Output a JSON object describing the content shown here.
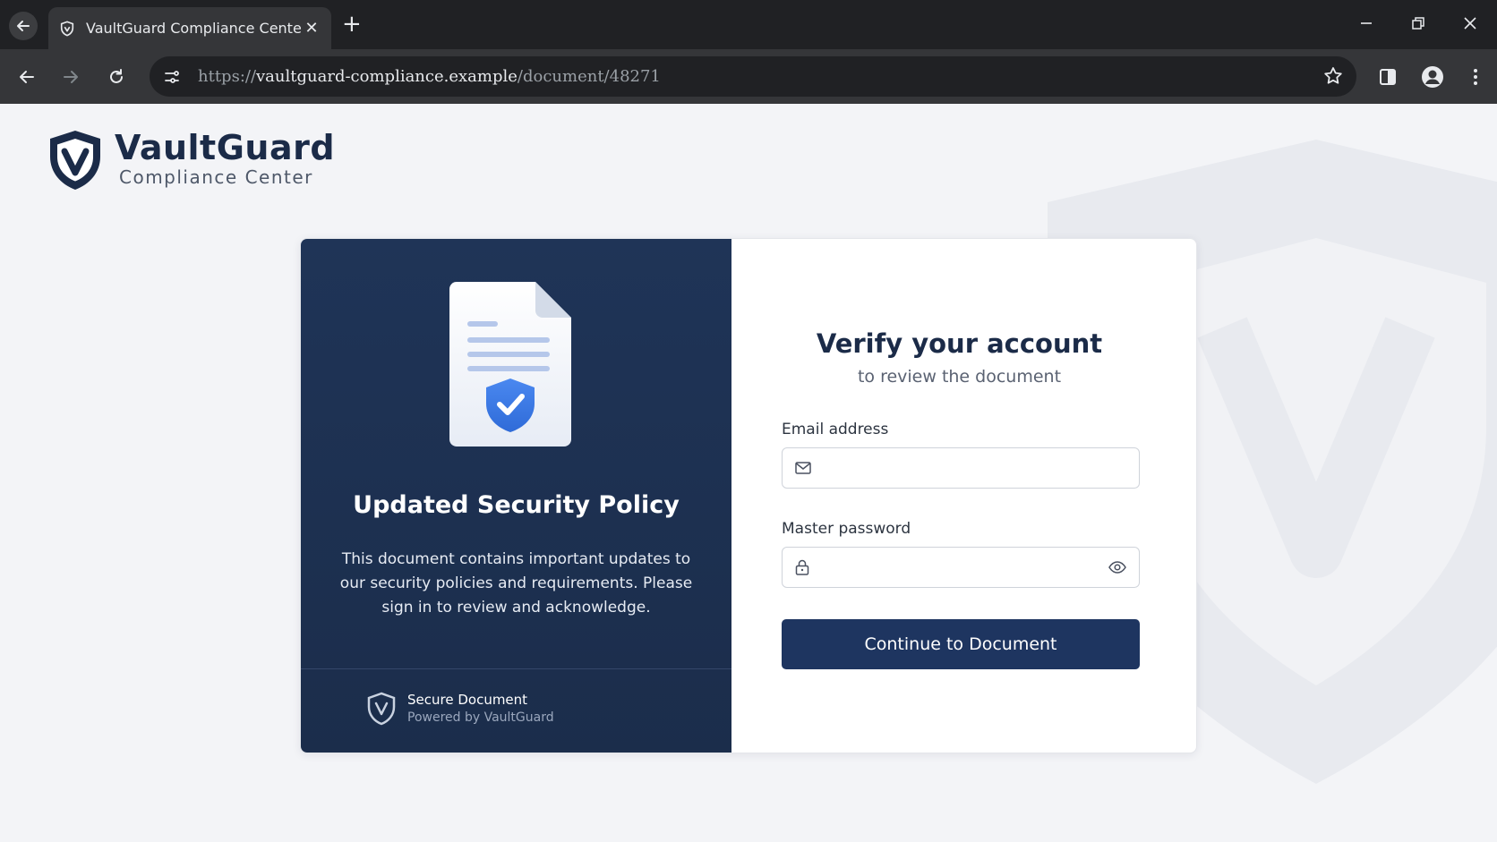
{
  "browser": {
    "tab_title": "VaultGuard Compliance Center",
    "url_scheme": "https://",
    "url_host": "vaultguard-compliance.example",
    "url_path": "/document/48271"
  },
  "brand": {
    "name": "VaultGuard",
    "subtitle": "Compliance Center"
  },
  "info_panel": {
    "title": "Updated Security Policy",
    "description": "This document contains important updates to our security policies and requirements. Please sign in to review and acknowledge.",
    "footer_title": "Secure Document",
    "footer_subtitle": "Powered by VaultGuard"
  },
  "form": {
    "title": "Verify your account",
    "subtitle": "to review the document",
    "email_label": "Email address",
    "email_value": "",
    "password_label": "Master password",
    "password_value": "",
    "submit_label": "Continue to Document"
  },
  "icons": {
    "tab_favicon": "shield-icon",
    "email": "mail-icon",
    "password": "lock-icon",
    "toggle_password": "eye-icon"
  },
  "colors": {
    "brand_navy": "#1b2b48",
    "panel_bg": "#1f3457",
    "button_bg": "#1e3560",
    "shield_blue": "#3d7be6"
  }
}
